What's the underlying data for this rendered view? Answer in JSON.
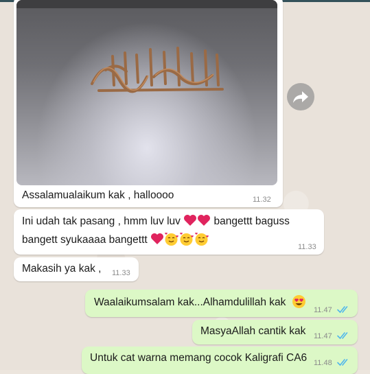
{
  "messages": [
    {
      "id": "img-caption",
      "direction": "in",
      "text": "Assalamualaikum kak , halloooo",
      "time": "11.32"
    },
    {
      "id": "m2",
      "direction": "in",
      "line1": "Ini udah tak pasang , hmm luv luv",
      "line1b": "bangettt baguss",
      "line2": "bangett syukaaaa bangettt",
      "time": "11.33"
    },
    {
      "id": "m3",
      "direction": "in",
      "text": "Makasih ya kak ,",
      "time": "11.33"
    },
    {
      "id": "m4",
      "direction": "out",
      "text": "Waalaikumsalam kak...Alhamdulillah kak",
      "time": "11.47"
    },
    {
      "id": "m5",
      "direction": "out",
      "text": "MasyaAllah cantik kak",
      "time": "11.47"
    },
    {
      "id": "m6",
      "direction": "out",
      "text": "Untuk cat warna memang cocok Kaligrafi CA6",
      "time": "11.48"
    }
  ],
  "colors": {
    "incoming": "#ffffff",
    "outgoing": "#dcf8c6",
    "read_ticks": "#4fb6ec",
    "heart": "#e0245e"
  },
  "icons": [
    "forward-icon",
    "heart-emoji",
    "smiling-face-with-hearts-emoji",
    "heart-eyes-emoji",
    "double-check-icon"
  ]
}
